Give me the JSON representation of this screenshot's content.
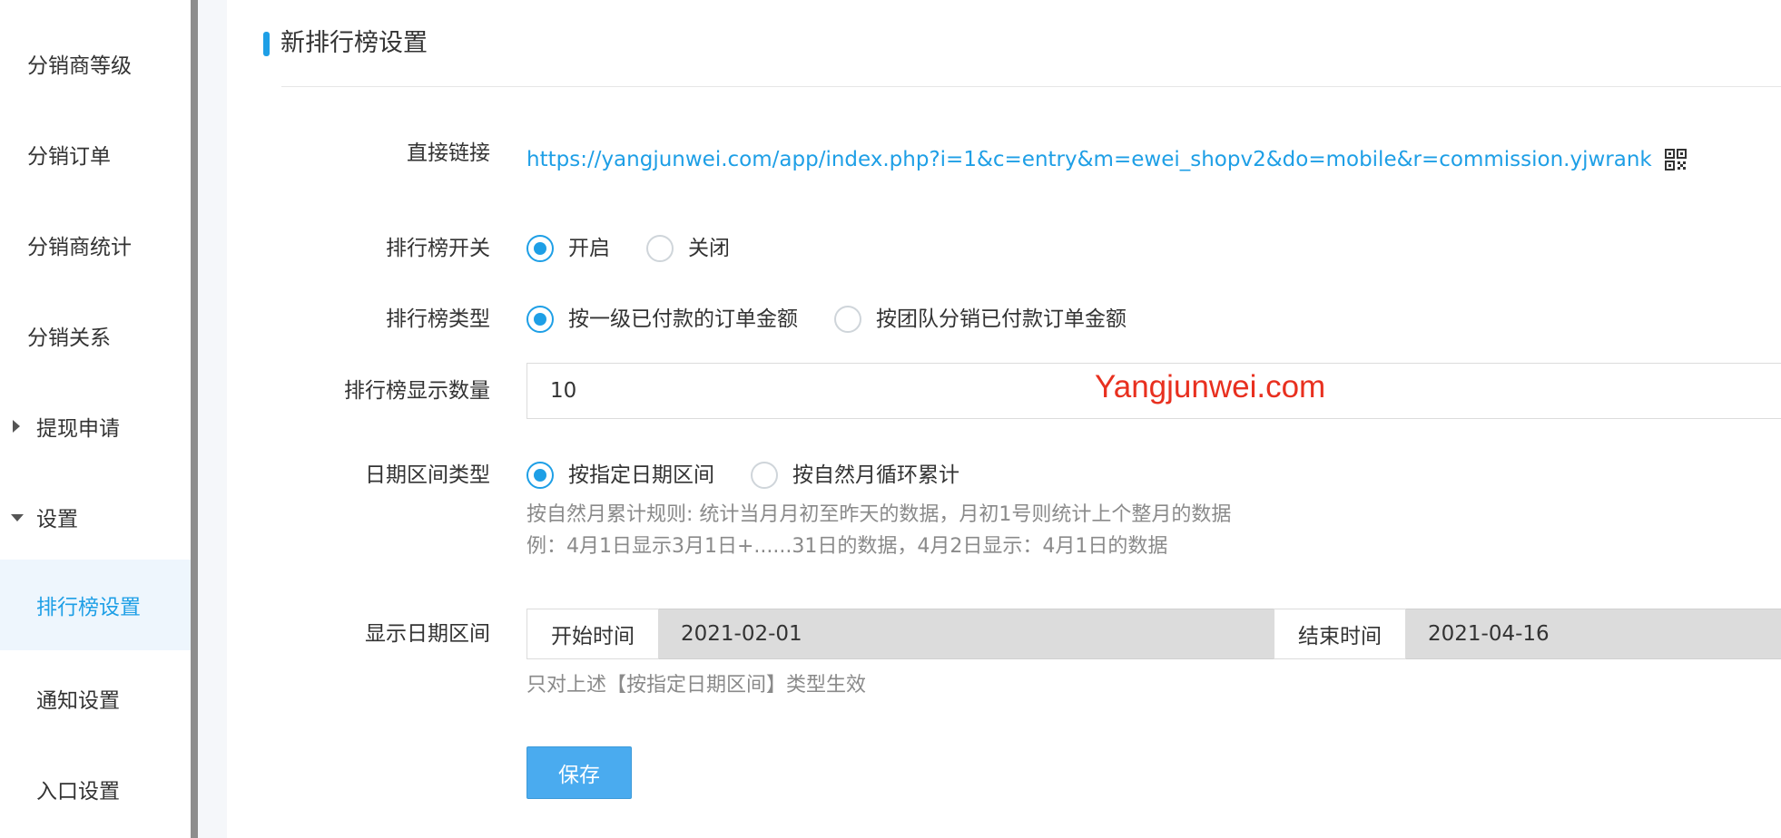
{
  "sidebar": {
    "items": [
      {
        "label": "分销商等级"
      },
      {
        "label": "分销订单"
      },
      {
        "label": "分销商统计"
      },
      {
        "label": "分销关系"
      },
      {
        "label": "提现申请"
      },
      {
        "label": "设置"
      },
      {
        "label": "排行榜设置"
      },
      {
        "label": "通知设置"
      },
      {
        "label": "入口设置"
      }
    ]
  },
  "page": {
    "title": "新排行榜设置"
  },
  "form": {
    "link": {
      "label": "直接链接",
      "url": "https://yangjunwei.com/app/index.php?i=1&c=entry&m=ewei_shopv2&do=mobile&r=commission.yjwrank"
    },
    "switch": {
      "label": "排行榜开关",
      "options": [
        "开启",
        "关闭"
      ],
      "selected": "开启"
    },
    "type": {
      "label": "排行榜类型",
      "options": [
        "按一级已付款的订单金额",
        "按团队分销已付款订单金额"
      ],
      "selected": "按一级已付款的订单金额"
    },
    "count": {
      "label": "排行榜显示数量",
      "value": "10"
    },
    "date_type": {
      "label": "日期区间类型",
      "options": [
        "按指定日期区间",
        "按自然月循环累计"
      ],
      "selected": "按指定日期区间",
      "help_line1": "按自然月累计规则: 统计当月月初至昨天的数据，月初1号则统计上个整月的数据",
      "help_line2": "例：4月1日显示3月1日+......31日的数据，4月2日显示：4月1日的数据"
    },
    "date_range": {
      "label": "显示日期区间",
      "start_label": "开始时间",
      "start_value": "2021-02-01",
      "end_label": "结束时间",
      "end_value": "2021-04-16",
      "help": "只对上述【按指定日期区间】类型生效"
    },
    "save_label": "保存"
  },
  "watermark": "Yangjunwei.com",
  "colors": {
    "accent": "#1e9fe6",
    "button": "#4aabef",
    "watermark": "#e8301f"
  }
}
